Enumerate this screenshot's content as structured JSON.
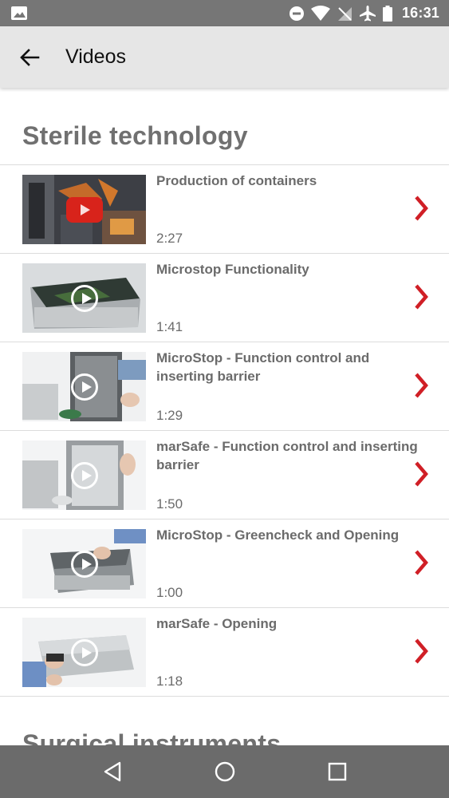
{
  "status_bar": {
    "time": "16:31",
    "icons": [
      "image-icon",
      "do-not-disturb-icon",
      "wifi-icon",
      "no-signal-icon",
      "airplane-mode-icon",
      "battery-icon"
    ]
  },
  "app_bar": {
    "title": "Videos",
    "back_icon": "arrow-back-icon"
  },
  "sections": [
    {
      "title": "Sterile technology",
      "videos": [
        {
          "title": "Production of containers",
          "duration": "2:27"
        },
        {
          "title": "Microstop Functionality",
          "duration": "1:41"
        },
        {
          "title": "MicroStop - Function control and inserting barrier",
          "duration": "1:29"
        },
        {
          "title": "marSafe - Function control and inserting barrier",
          "duration": "1:50"
        },
        {
          "title": "MicroStop - Greencheck and Opening",
          "duration": "1:00"
        },
        {
          "title": "marSafe - Opening",
          "duration": "1:18"
        }
      ]
    },
    {
      "title": "Surgical instruments"
    }
  ],
  "nav_bar": {
    "icons": [
      "back-triangle-icon",
      "home-circle-icon",
      "recents-square-icon"
    ]
  },
  "colors": {
    "accent": "#d01f26",
    "status_bar": "#767676",
    "app_bar": "#e6e6e6",
    "nav_bar": "#6b6b6b"
  }
}
